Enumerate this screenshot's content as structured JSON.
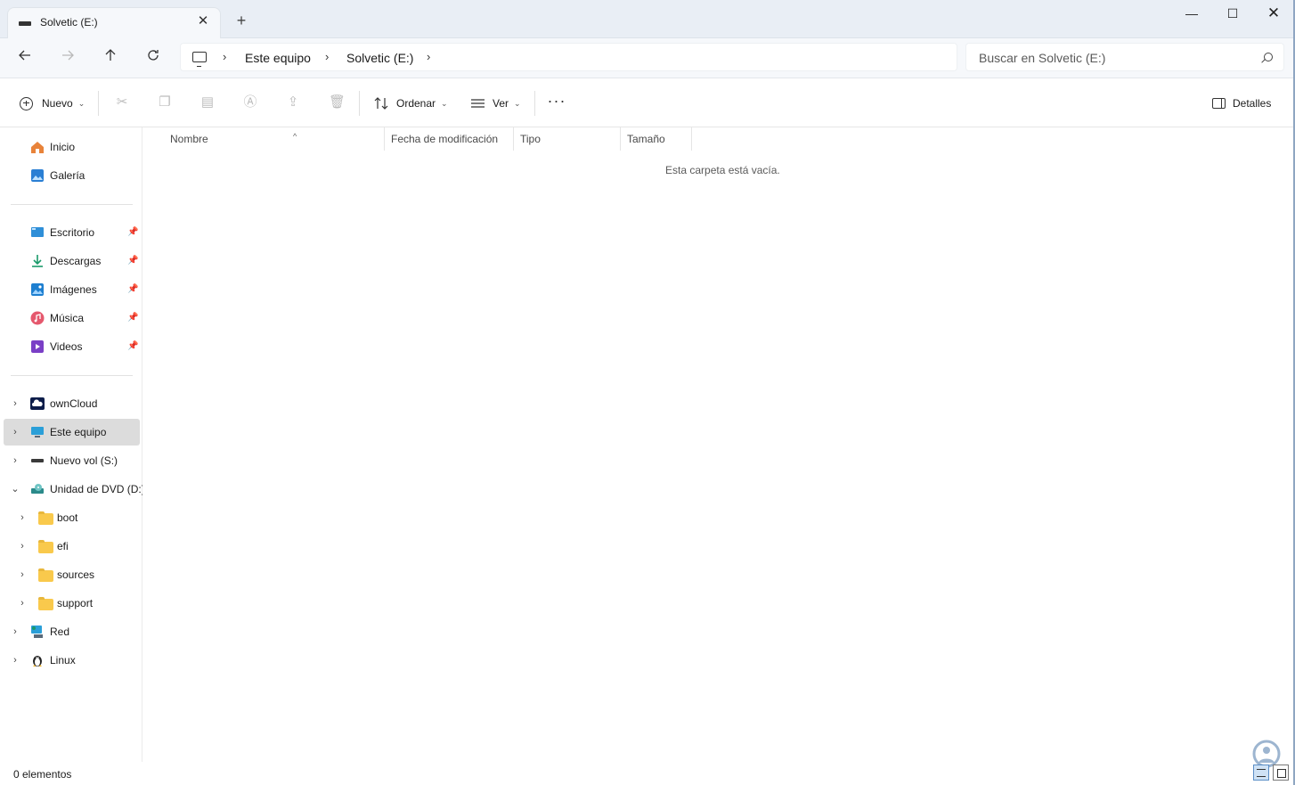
{
  "window": {
    "tab_title": "Solvetic (E:)",
    "minimize_glyph": "—",
    "maximize_glyph": "☐",
    "close_glyph": "✕",
    "new_tab_glyph": "+",
    "tab_close_glyph": "✕"
  },
  "address": {
    "breadcrumb": [
      "Este equipo",
      "Solvetic (E:)"
    ],
    "search_placeholder": "Buscar en Solvetic (E:)",
    "back_icon": "arrow-left-icon",
    "forward_icon": "arrow-right-icon",
    "up_icon": "arrow-up-icon",
    "refresh_icon": "refresh-icon"
  },
  "commands": {
    "new_label": "Nuevo",
    "sort_label": "Ordenar",
    "view_label": "Ver",
    "details_label": "Detalles",
    "more_glyph": "···"
  },
  "sidebar": {
    "quick": [
      {
        "label": "Inicio",
        "icon": "home-icon"
      },
      {
        "label": "Galería",
        "icon": "gallery-icon"
      }
    ],
    "pinned": [
      {
        "label": "Escritorio",
        "icon": "desktop-icon"
      },
      {
        "label": "Descargas",
        "icon": "download-icon"
      },
      {
        "label": "Imágenes",
        "icon": "pictures-icon"
      },
      {
        "label": "Música",
        "icon": "music-icon"
      },
      {
        "label": "Videos",
        "icon": "videos-icon"
      }
    ],
    "tree": [
      {
        "label": "ownCloud",
        "icon": "cloud-icon",
        "expanded": false
      },
      {
        "label": "Este equipo",
        "icon": "this-pc-icon",
        "expanded": false,
        "selected": true
      },
      {
        "label": "Nuevo vol (S:)",
        "icon": "drive-icon",
        "expanded": false
      },
      {
        "label": "Unidad de DVD (D:)",
        "icon": "dvd-drive-icon",
        "expanded": true
      },
      {
        "label": "boot",
        "icon": "folder-icon",
        "child": true
      },
      {
        "label": "efi",
        "icon": "folder-icon",
        "child": true
      },
      {
        "label": "sources",
        "icon": "folder-icon",
        "child": true
      },
      {
        "label": "support",
        "icon": "folder-icon",
        "child": true
      },
      {
        "label": "Red",
        "icon": "network-icon",
        "expanded": false
      },
      {
        "label": "Linux",
        "icon": "linux-icon",
        "expanded": false
      }
    ]
  },
  "columns": [
    "Nombre",
    "Fecha de modificación",
    "Tipo",
    "Tamaño"
  ],
  "empty_message": "Esta carpeta está vacía.",
  "status": {
    "item_count": "0 elementos"
  },
  "colors": {
    "accent": "#0067c0",
    "selected_bg": "#dcdcdc",
    "folder": "#f9c94c"
  }
}
